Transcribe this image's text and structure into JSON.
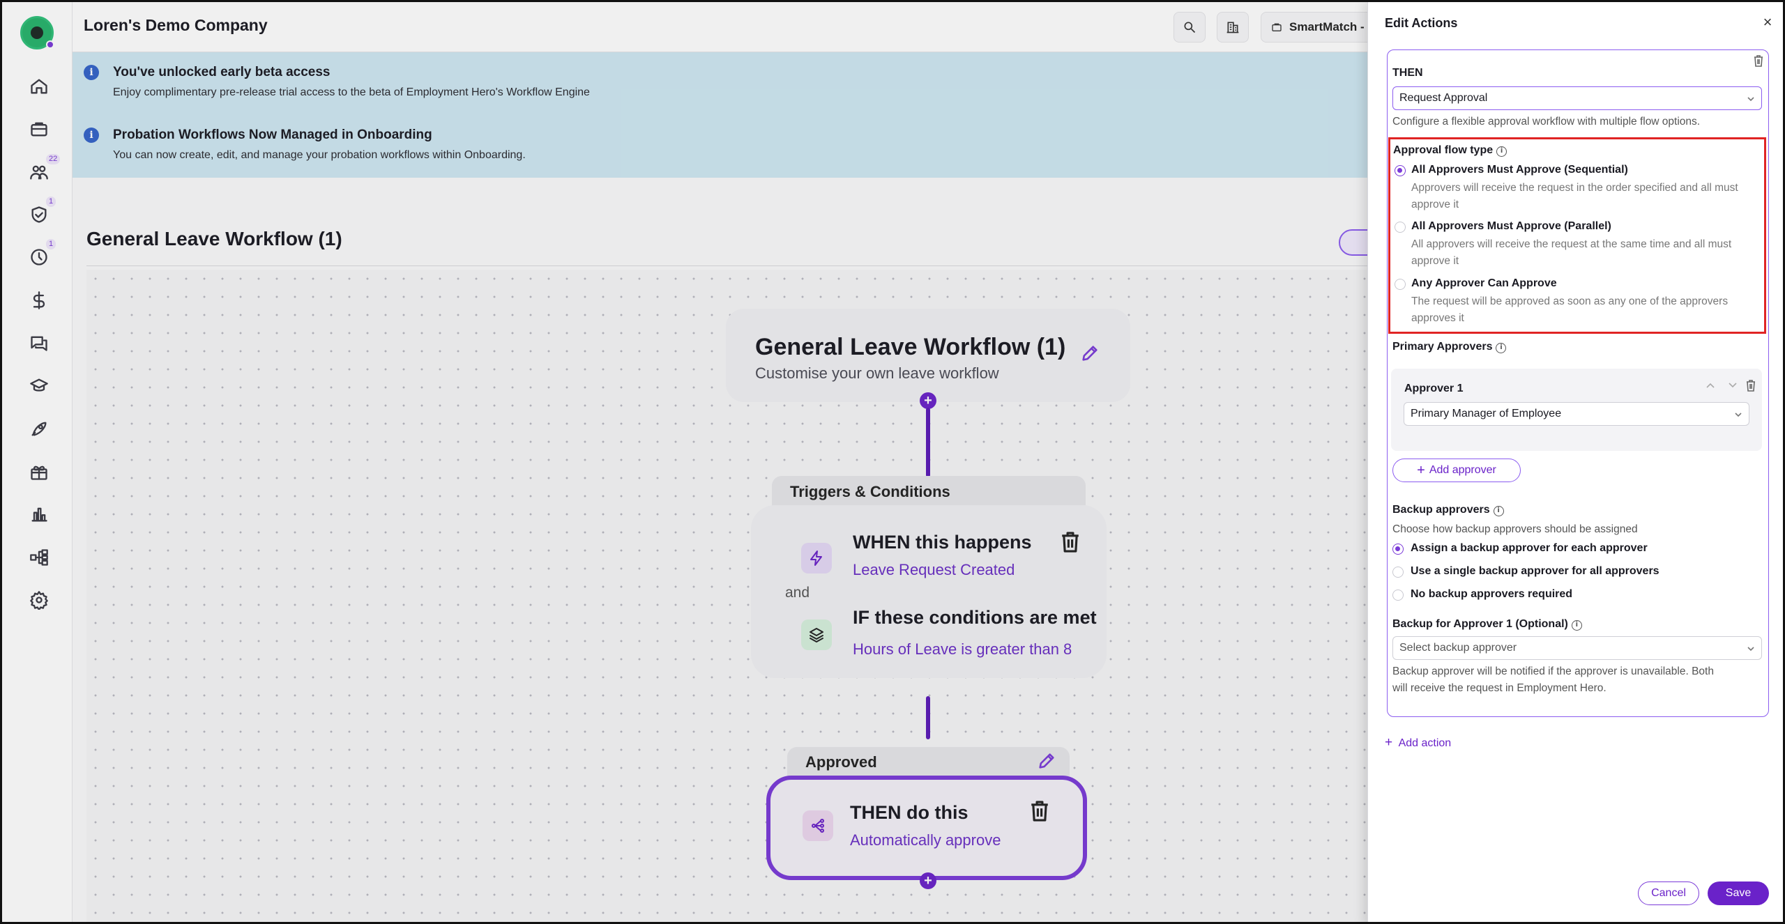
{
  "company": "Loren's Demo Company",
  "topbar": {
    "smartmatch_label": "SmartMatch -",
    "icons": [
      "search-icon",
      "building-icon",
      "briefcase-icon"
    ]
  },
  "sidebar": {
    "items": [
      {
        "name": "home-icon",
        "badge": ""
      },
      {
        "name": "briefcase-icon",
        "badge": ""
      },
      {
        "name": "people-icon",
        "badge": "22"
      },
      {
        "name": "shield-check-icon",
        "badge": "1"
      },
      {
        "name": "clock-icon",
        "badge": "1"
      },
      {
        "name": "dollar-icon",
        "badge": ""
      },
      {
        "name": "chat-icon",
        "badge": ""
      },
      {
        "name": "graduation-cap-icon",
        "badge": ""
      },
      {
        "name": "rocket-icon",
        "badge": ""
      },
      {
        "name": "gift-icon",
        "badge": ""
      },
      {
        "name": "bar-chart-icon",
        "badge": ""
      },
      {
        "name": "workflow-icon",
        "badge": ""
      },
      {
        "name": "gear-icon",
        "badge": ""
      }
    ]
  },
  "banners": [
    {
      "title": "You've unlocked early beta access",
      "desc": "Enjoy complimentary pre-release trial access to the beta of Employment Hero's Workflow Engine"
    },
    {
      "title": "Probation Workflows Now Managed in Onboarding",
      "desc": "You can now create, edit, and manage your probation workflows within Onboarding."
    }
  ],
  "workflow": {
    "page_title": "General Leave Workflow (1)",
    "start": {
      "title": "General Leave Workflow (1)",
      "subtitle": "Customise your own leave workflow"
    },
    "triggers": {
      "label": "Triggers & Conditions",
      "when_title": "WHEN this happens",
      "when_value": "Leave Request Created",
      "and": "and",
      "if_title": "IF these conditions are met",
      "if_value": "Hours of Leave is greater than 8"
    },
    "approved": {
      "label": "Approved",
      "then_title": "THEN do this",
      "then_value": "Automatically approve"
    }
  },
  "drawer": {
    "title": "Edit Actions",
    "close": "×",
    "then_label": "THEN",
    "action_select": "Request Approval",
    "action_desc": "Configure a flexible approval workflow with multiple flow options.",
    "flow_type_label": "Approval flow type",
    "flow_options": [
      {
        "title": "All Approvers Must Approve (Sequential)",
        "desc": "Approvers will receive the request in the order specified and all must approve it",
        "selected": true
      },
      {
        "title": "All Approvers Must Approve (Parallel)",
        "desc": "All approvers will receive the request at the same time and all must approve it",
        "selected": false
      },
      {
        "title": "Any Approver Can Approve",
        "desc": "The request will be approved as soon as any one of the approvers approves it",
        "selected": false
      }
    ],
    "primary_label": "Primary Approvers",
    "approver": {
      "label": "Approver 1",
      "select": "Primary Manager of Employee"
    },
    "add_approver": "Add approver",
    "backup_label": "Backup approvers",
    "backup_desc": "Choose how backup approvers should be assigned",
    "backup_options": [
      {
        "label": "Assign a backup approver for each approver",
        "selected": true
      },
      {
        "label": "Use a single backup approver for all approvers",
        "selected": false
      },
      {
        "label": "No backup approvers required",
        "selected": false
      }
    ],
    "backup_for_label": "Backup for Approver 1 (Optional)",
    "backup_select_placeholder": "Select backup approver",
    "backup_note_1": "Backup approver will be notified if the approver is unavailable. Both",
    "backup_note_2": "will receive the request in Employment Hero.",
    "add_action": "Add action",
    "cancel": "Cancel",
    "save": "Save"
  },
  "colors": {
    "accent": "#6a22c9",
    "banner_bg": "#cfe8f2",
    "highlight_border": "#e02424"
  }
}
